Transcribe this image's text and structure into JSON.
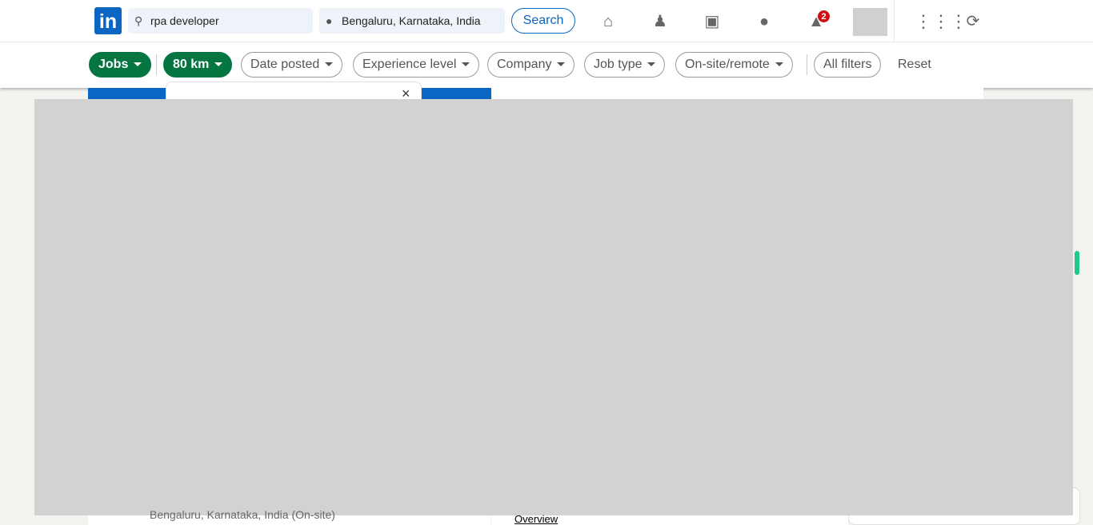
{
  "header": {
    "logo": "in",
    "search_value": "rpa developer",
    "location_value": "Bengaluru, Karnataka, India",
    "search_label": "Search",
    "notification_count": "2",
    "nav_icons": [
      "home-icon",
      "my-network-icon",
      "jobs-icon",
      "messaging-icon",
      "notifications-icon",
      "apps-grid-icon",
      "premium-icon"
    ]
  },
  "filters": {
    "jobs": "Jobs",
    "distance": "80 km",
    "date_posted": "Date posted",
    "experience": "Experience level",
    "company": "Company",
    "job_type": "Job type",
    "onsite": "On-site/remote",
    "all_filters": "All filters",
    "reset": "Reset"
  },
  "colors": {
    "brand": "#0a66c2",
    "active_filter": "#057642",
    "badge": "#cc1016"
  },
  "popup": {
    "close": "×"
  },
  "footer": {
    "job_location": "Bengaluru, Karnataka, India (On-site)",
    "overview_tab": "Overview"
  }
}
